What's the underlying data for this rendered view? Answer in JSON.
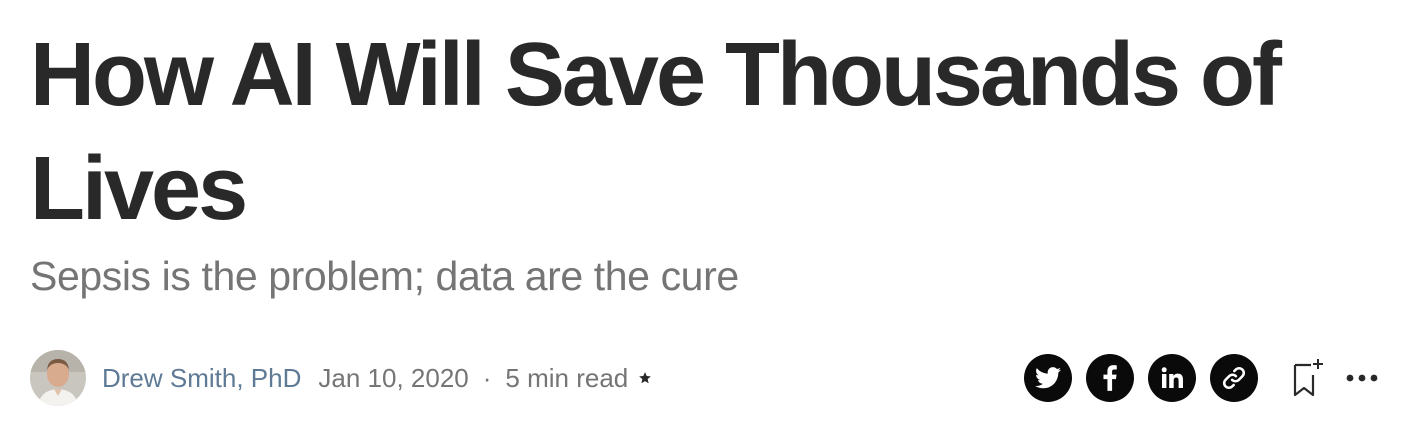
{
  "article": {
    "title": "How AI Will Save Thousands of Lives",
    "subtitle": "Sepsis is the problem; data are the cure"
  },
  "byline": {
    "author": "Drew Smith, PhD",
    "date": "Jan 10, 2020",
    "separator": "·",
    "read_time": "5 min read",
    "member_only": true
  },
  "share": {
    "buttons": [
      "twitter-icon",
      "facebook-icon",
      "linkedin-icon",
      "link-icon"
    ],
    "bookmark_icon": "bookmark-add-icon",
    "more_icon": "more-horizontal-icon"
  },
  "colors": {
    "title": "#292929",
    "subtitle": "#757575",
    "author_link": "#5f7a95",
    "icon_circle": "#0a0a0a"
  }
}
